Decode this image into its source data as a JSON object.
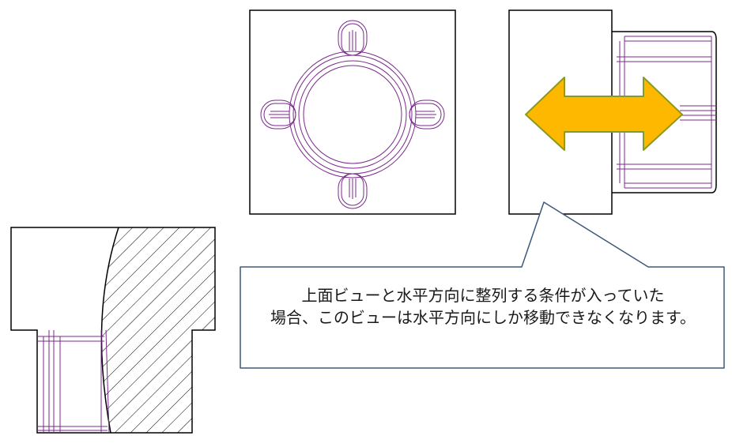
{
  "callout": {
    "line1": "上面ビューと水平方向に整列する条件が入っていた",
    "line2": "場合、このビューは水平方向にしか移動できなくなります。"
  },
  "colors": {
    "outline": "#000000",
    "edge": "#7a2a8c",
    "arrow_fill": "#ffb800",
    "arrow_stroke": "#8a9a1c",
    "callout_border": "#3c5a7a"
  },
  "icons": {
    "move_arrow": "double-headed-horizontal-arrow"
  }
}
